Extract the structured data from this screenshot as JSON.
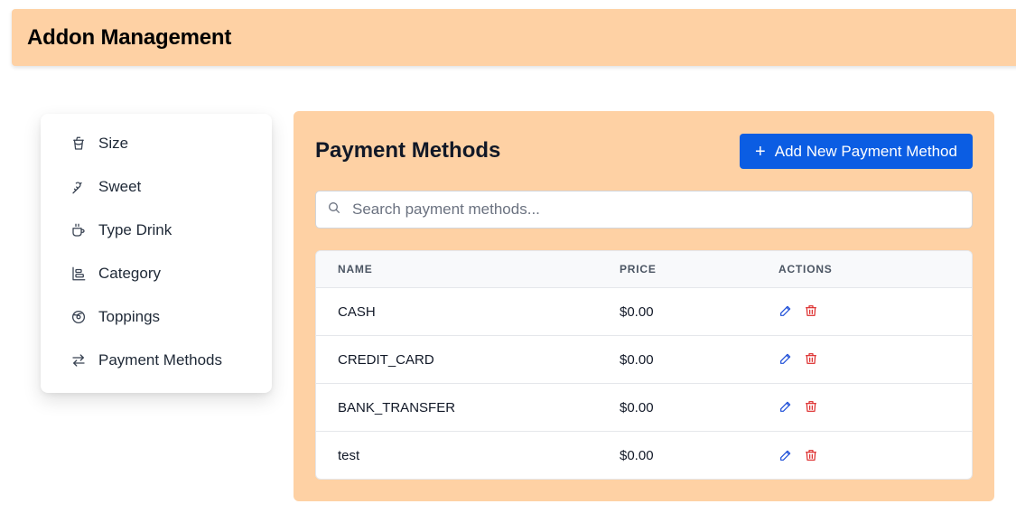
{
  "header": {
    "title": "Addon Management"
  },
  "sidebar": {
    "items": [
      {
        "label": "Size",
        "icon": "cup-icon"
      },
      {
        "label": "Sweet",
        "icon": "candy-cane-icon"
      },
      {
        "label": "Type Drink",
        "icon": "coffee-icon"
      },
      {
        "label": "Category",
        "icon": "category-icon"
      },
      {
        "label": "Toppings",
        "icon": "donut-icon"
      },
      {
        "label": "Payment Methods",
        "icon": "arrows-exchange-icon"
      }
    ]
  },
  "main": {
    "title": "Payment Methods",
    "add_button": {
      "icon": "plus-icon",
      "label": "Add New Payment Method"
    },
    "search": {
      "placeholder": "Search payment methods...",
      "value": ""
    },
    "table": {
      "columns": [
        "NAME",
        "PRICE",
        "ACTIONS"
      ],
      "rows": [
        {
          "name": "CASH",
          "price": "$0.00"
        },
        {
          "name": "CREDIT_CARD",
          "price": "$0.00"
        },
        {
          "name": "BANK_TRANSFER",
          "price": "$0.00"
        },
        {
          "name": "test",
          "price": "$0.00"
        }
      ]
    }
  },
  "colors": {
    "header_bg": "#fed1a4",
    "panel_bg": "#fed1a4",
    "primary_button": "#0b5de3",
    "edit_icon": "#1d4ed8",
    "delete_icon": "#dc2626"
  }
}
